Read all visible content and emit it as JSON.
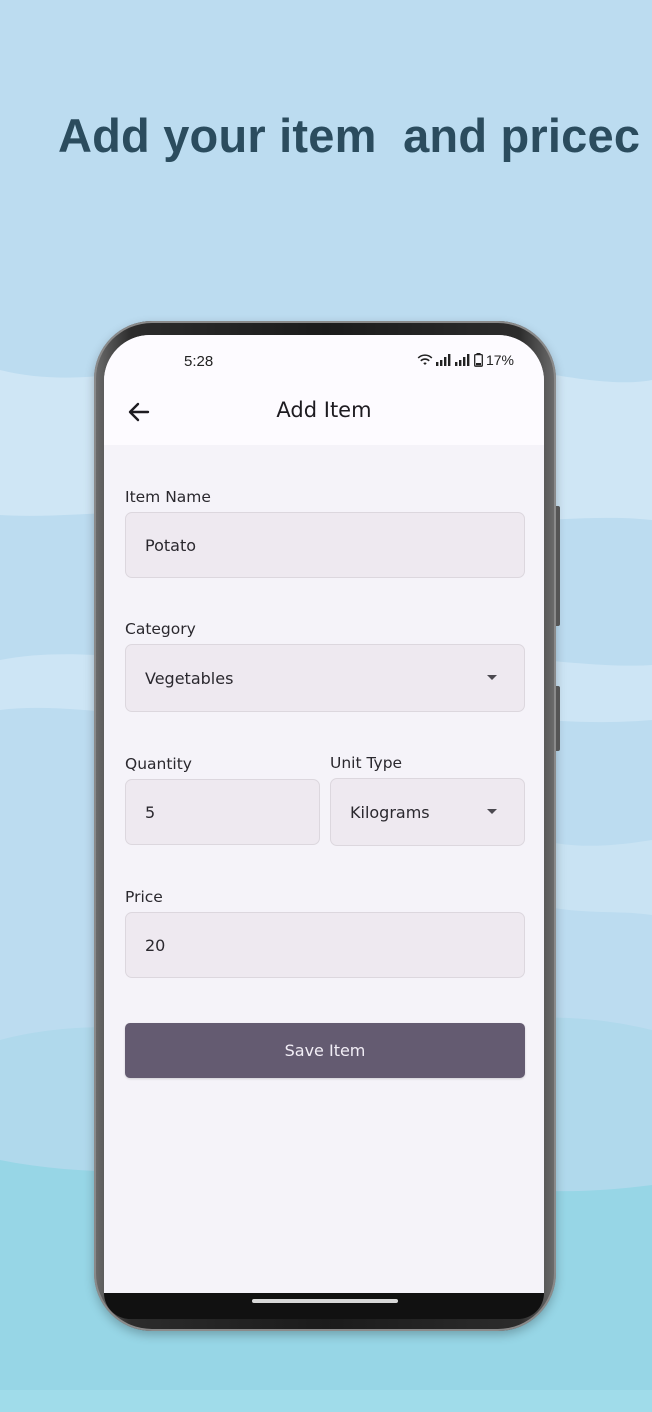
{
  "headline": "Add your item  and pricec",
  "status_bar": {
    "time": "5:28",
    "battery": "17%"
  },
  "app_bar": {
    "title": "Add Item",
    "back_icon": "arrow-left-icon"
  },
  "form": {
    "item_name": {
      "label": "Item Name",
      "value": "Potato"
    },
    "category": {
      "label": "Category",
      "value": "Vegetables"
    },
    "quantity": {
      "label": "Quantity",
      "value": "5"
    },
    "unit_type": {
      "label": "Unit Type",
      "value": "Kilograms"
    },
    "price": {
      "label": "Price",
      "value": "20"
    },
    "save_label": "Save Item"
  },
  "colors": {
    "background": "#bcdcf0",
    "headline": "#2b4c5e",
    "button": "#645b71",
    "field_bg": "#eee9f0"
  }
}
